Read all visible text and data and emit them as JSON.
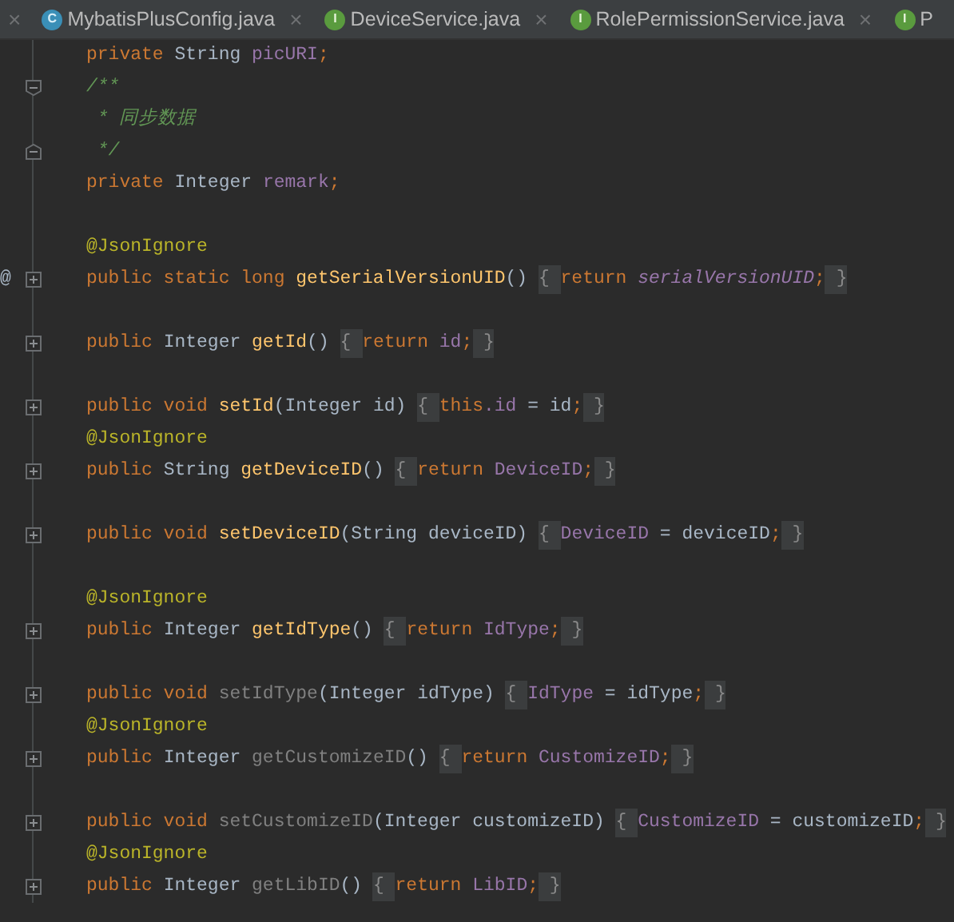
{
  "tabs_leading_close": "×",
  "tabs": [
    {
      "kind": "class",
      "icon_letter": "C",
      "label": "MybatisPlusConfig.java",
      "close": "×"
    },
    {
      "kind": "interface",
      "icon_letter": "I",
      "label": "DeviceService.java",
      "close": "×"
    },
    {
      "kind": "interface",
      "icon_letter": "I",
      "label": "RolePermissionService.java",
      "close": "×"
    },
    {
      "kind": "interface",
      "icon_letter": "I",
      "label": "P"
    }
  ],
  "lines": [
    {
      "kind": "code",
      "tokens": [
        {
          "kind": "kw",
          "text": "private "
        },
        {
          "kind": "type",
          "text": "String "
        },
        {
          "kind": "field",
          "text": "picURI"
        },
        {
          "kind": "kw",
          "text": ";"
        }
      ]
    },
    {
      "kind": "code",
      "fold": {
        "kind": "start"
      },
      "tokens": [
        {
          "kind": "comment",
          "text": "/**"
        }
      ]
    },
    {
      "kind": "code",
      "tokens": [
        {
          "kind": "comment",
          "text": " * 同步数据"
        }
      ]
    },
    {
      "kind": "code",
      "fold": {
        "kind": "end"
      },
      "tokens": [
        {
          "kind": "comment",
          "text": " */"
        }
      ]
    },
    {
      "kind": "code",
      "tokens": [
        {
          "kind": "kw",
          "text": "private "
        },
        {
          "kind": "type",
          "text": "Integer "
        },
        {
          "kind": "field",
          "text": "remark"
        },
        {
          "kind": "kw",
          "text": ";"
        }
      ]
    },
    {
      "kind": "blank"
    },
    {
      "kind": "code",
      "tokens": [
        {
          "kind": "ann",
          "text": "@JsonIgnore"
        }
      ]
    },
    {
      "kind": "code",
      "gutter_mark": "@",
      "fold": {
        "kind": "collapsed"
      },
      "tokens": [
        {
          "kind": "kw",
          "text": "public static long "
        },
        {
          "kind": "method",
          "text": "getSerialVersionUID"
        },
        {
          "kind": "plain",
          "text": "() "
        },
        {
          "kind": "fold",
          "text": "{ "
        },
        {
          "kind": "kw",
          "text": "return "
        },
        {
          "kind": "static",
          "text": "serialVersionUID"
        },
        {
          "kind": "kw",
          "text": ";"
        },
        {
          "kind": "fold",
          "text": " }"
        }
      ]
    },
    {
      "kind": "blank"
    },
    {
      "kind": "code",
      "fold": {
        "kind": "collapsed"
      },
      "tokens": [
        {
          "kind": "kw",
          "text": "public "
        },
        {
          "kind": "type",
          "text": "Integer "
        },
        {
          "kind": "method",
          "text": "getId"
        },
        {
          "kind": "plain",
          "text": "() "
        },
        {
          "kind": "fold",
          "text": "{ "
        },
        {
          "kind": "kw",
          "text": "return "
        },
        {
          "kind": "field",
          "text": "id"
        },
        {
          "kind": "kw",
          "text": ";"
        },
        {
          "kind": "fold",
          "text": " }"
        }
      ]
    },
    {
      "kind": "blank"
    },
    {
      "kind": "code",
      "fold": {
        "kind": "collapsed"
      },
      "tokens": [
        {
          "kind": "kw",
          "text": "public void "
        },
        {
          "kind": "method",
          "text": "setId"
        },
        {
          "kind": "plain",
          "text": "(Integer id) "
        },
        {
          "kind": "fold",
          "text": "{ "
        },
        {
          "kind": "kw",
          "text": "this"
        },
        {
          "kind": "field",
          "text": ".id"
        },
        {
          "kind": "plain",
          "text": " = id"
        },
        {
          "kind": "kw",
          "text": ";"
        },
        {
          "kind": "fold",
          "text": " }"
        }
      ]
    },
    {
      "kind": "code",
      "tokens": [
        {
          "kind": "ann",
          "text": "@JsonIgnore"
        }
      ]
    },
    {
      "kind": "code",
      "fold": {
        "kind": "collapsed"
      },
      "tokens": [
        {
          "kind": "kw",
          "text": "public "
        },
        {
          "kind": "type",
          "text": "String "
        },
        {
          "kind": "method",
          "text": "getDeviceID"
        },
        {
          "kind": "plain",
          "text": "() "
        },
        {
          "kind": "fold",
          "text": "{ "
        },
        {
          "kind": "kw",
          "text": "return "
        },
        {
          "kind": "field",
          "text": "DeviceID"
        },
        {
          "kind": "kw",
          "text": ";"
        },
        {
          "kind": "fold",
          "text": " }"
        }
      ]
    },
    {
      "kind": "blank"
    },
    {
      "kind": "code",
      "fold": {
        "kind": "collapsed"
      },
      "tokens": [
        {
          "kind": "kw",
          "text": "public void "
        },
        {
          "kind": "method",
          "text": "setDeviceID"
        },
        {
          "kind": "plain",
          "text": "(String deviceID) "
        },
        {
          "kind": "fold",
          "text": "{ "
        },
        {
          "kind": "field",
          "text": "DeviceID"
        },
        {
          "kind": "plain",
          "text": " = deviceID"
        },
        {
          "kind": "kw",
          "text": ";"
        },
        {
          "kind": "fold",
          "text": " }"
        }
      ]
    },
    {
      "kind": "blank"
    },
    {
      "kind": "code",
      "tokens": [
        {
          "kind": "ann",
          "text": "@JsonIgnore"
        }
      ]
    },
    {
      "kind": "code",
      "fold": {
        "kind": "collapsed"
      },
      "tokens": [
        {
          "kind": "kw",
          "text": "public "
        },
        {
          "kind": "type",
          "text": "Integer "
        },
        {
          "kind": "method",
          "text": "getIdType"
        },
        {
          "kind": "plain",
          "text": "() "
        },
        {
          "kind": "fold",
          "text": "{ "
        },
        {
          "kind": "kw",
          "text": "return "
        },
        {
          "kind": "field",
          "text": "IdType"
        },
        {
          "kind": "kw",
          "text": ";"
        },
        {
          "kind": "fold",
          "text": " }"
        }
      ]
    },
    {
      "kind": "blank"
    },
    {
      "kind": "code",
      "fold": {
        "kind": "collapsed"
      },
      "tokens": [
        {
          "kind": "kw",
          "text": "public void "
        },
        {
          "kind": "unused",
          "text": "setIdType"
        },
        {
          "kind": "plain",
          "text": "(Integer idType) "
        },
        {
          "kind": "fold",
          "text": "{ "
        },
        {
          "kind": "field",
          "text": "IdType"
        },
        {
          "kind": "plain",
          "text": " = idType"
        },
        {
          "kind": "kw",
          "text": ";"
        },
        {
          "kind": "fold",
          "text": " }"
        }
      ]
    },
    {
      "kind": "code",
      "tokens": [
        {
          "kind": "ann",
          "text": "@JsonIgnore"
        }
      ]
    },
    {
      "kind": "code",
      "fold": {
        "kind": "collapsed"
      },
      "tokens": [
        {
          "kind": "kw",
          "text": "public "
        },
        {
          "kind": "type",
          "text": "Integer "
        },
        {
          "kind": "unused",
          "text": "getCustomizeID"
        },
        {
          "kind": "plain",
          "text": "() "
        },
        {
          "kind": "fold",
          "text": "{ "
        },
        {
          "kind": "kw",
          "text": "return "
        },
        {
          "kind": "field",
          "text": "CustomizeID"
        },
        {
          "kind": "kw",
          "text": ";"
        },
        {
          "kind": "fold",
          "text": " }"
        }
      ]
    },
    {
      "kind": "blank"
    },
    {
      "kind": "code",
      "fold": {
        "kind": "collapsed"
      },
      "tokens": [
        {
          "kind": "kw",
          "text": "public void "
        },
        {
          "kind": "unused",
          "text": "setCustomizeID"
        },
        {
          "kind": "plain",
          "text": "(Integer customizeID) "
        },
        {
          "kind": "fold",
          "text": "{ "
        },
        {
          "kind": "field",
          "text": "CustomizeID"
        },
        {
          "kind": "plain",
          "text": " = customizeID"
        },
        {
          "kind": "kw",
          "text": ";"
        },
        {
          "kind": "fold",
          "text": " }"
        }
      ]
    },
    {
      "kind": "code",
      "tokens": [
        {
          "kind": "ann",
          "text": "@JsonIgnore"
        }
      ]
    },
    {
      "kind": "code",
      "fold": {
        "kind": "collapsed"
      },
      "tokens": [
        {
          "kind": "kw",
          "text": "public "
        },
        {
          "kind": "type",
          "text": "Integer "
        },
        {
          "kind": "unused",
          "text": "getLibID"
        },
        {
          "kind": "plain",
          "text": "() "
        },
        {
          "kind": "fold",
          "text": "{ "
        },
        {
          "kind": "kw",
          "text": "return "
        },
        {
          "kind": "field",
          "text": "LibID"
        },
        {
          "kind": "kw",
          "text": ";"
        },
        {
          "kind": "fold",
          "text": " }"
        }
      ]
    }
  ]
}
